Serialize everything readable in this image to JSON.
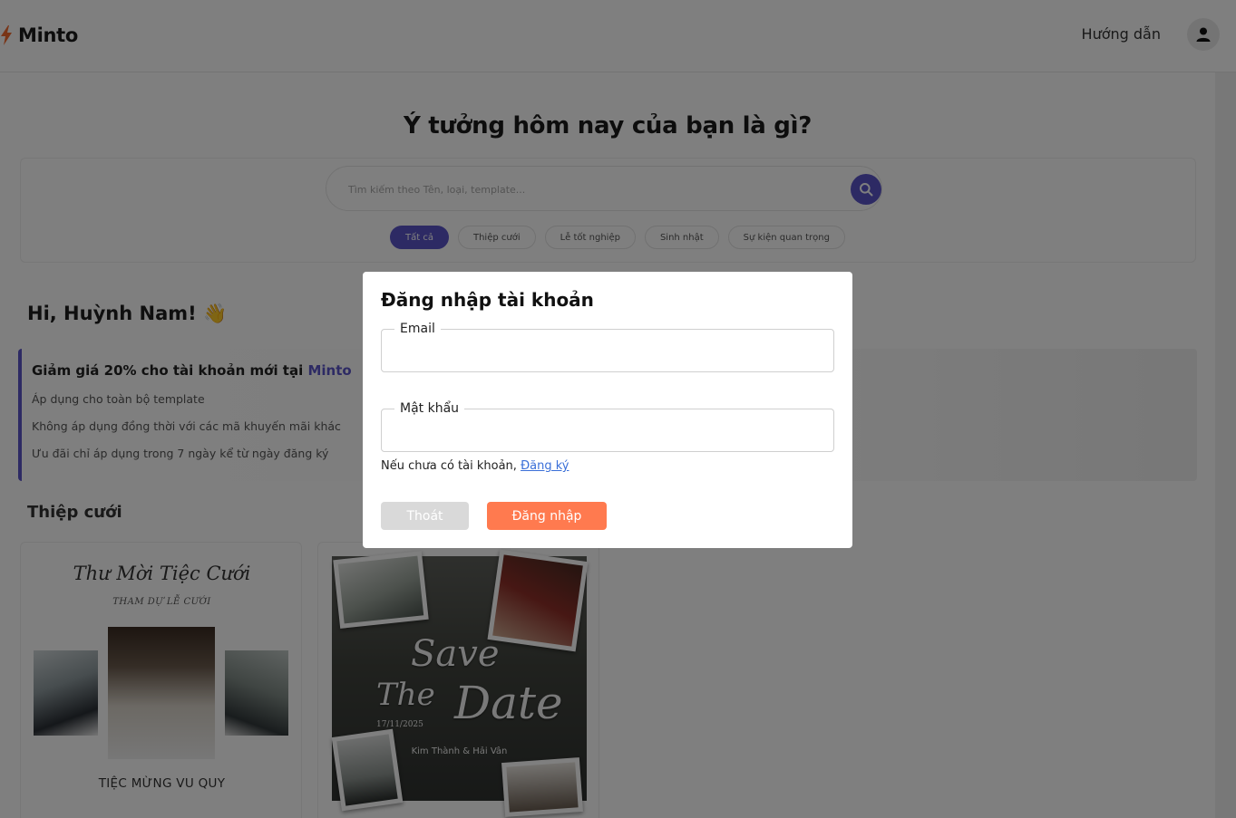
{
  "app": {
    "name": "Minto"
  },
  "header": {
    "guide_label": "Hướng dẫn"
  },
  "hero": {
    "title": "Ý tưởng hôm nay của bạn là gì?",
    "search_placeholder": "Tìm kiếm theo Tên, loại, template...",
    "chips": [
      "Tất cả",
      "Thiệp cưới",
      "Lễ tốt nghiệp",
      "Sinh nhật",
      "Sự kiện quan trọng"
    ]
  },
  "greeting": "Hi, Huỳnh Nam! 👋",
  "promo": {
    "title_prefix": "Giảm giá 20% cho tài khoản mới tại ",
    "title_brand": "Minto",
    "lines": [
      "Áp dụng cho toàn bộ template",
      "Không áp dụng đồng thời với các mã khuyến mãi khác",
      "Ưu đãi chỉ áp dụng trong 7 ngày kể từ ngày đăng ký"
    ]
  },
  "section": {
    "title": "Thiệp cưới",
    "cards": [
      {
        "title": "Thư Mời Tiệc Cưới",
        "subtitle": "THAM DỰ LỄ CƯỚI",
        "caption": "TIỆC MỪNG VU QUY"
      },
      {
        "script_save": "Save",
        "script_the": "The",
        "script_date": "Date",
        "date": "17/11/2025",
        "names": "Kim Thành & Hải Vân"
      }
    ]
  },
  "modal": {
    "title": "Đăng nhập tài khoản",
    "email_label": "Email",
    "email_value": "",
    "password_label": "Mật khẩu",
    "password_value": "",
    "register_prompt": "Nếu chưa có tài khoản, ",
    "register_link": "Đăng ký",
    "cancel_label": "Thoát",
    "login_label": "Đăng nhập"
  },
  "colors": {
    "accent": "#5b55c9",
    "login_button": "#ff7a4f",
    "logo_bolt": "#f26a2e"
  }
}
